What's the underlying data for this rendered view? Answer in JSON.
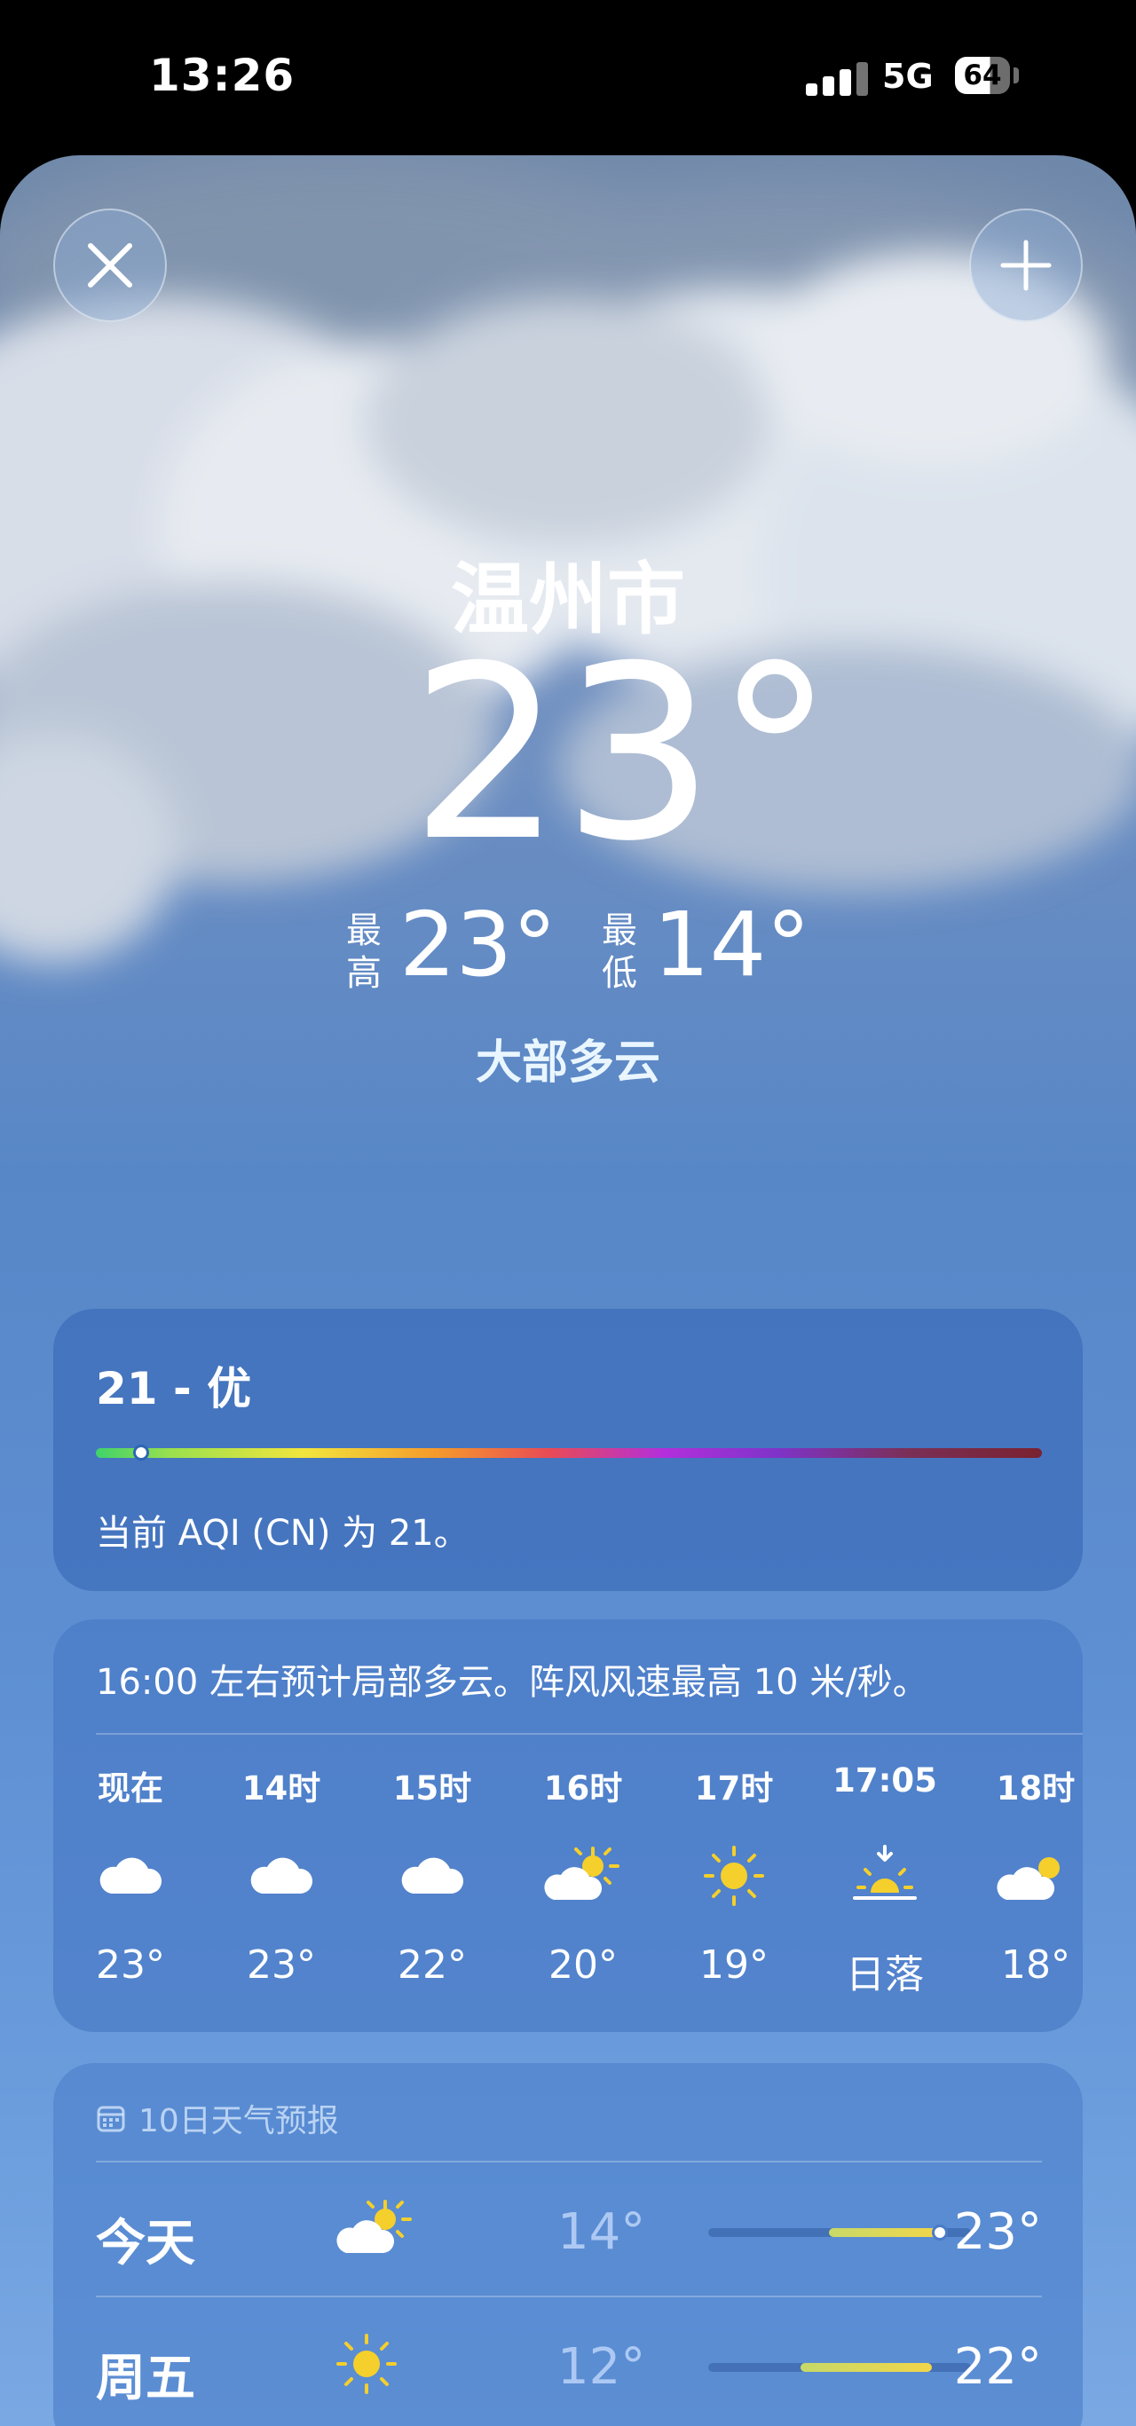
{
  "status": {
    "time": "13:26",
    "network": "5G",
    "battery": "64"
  },
  "header": {
    "close_icon": "close-icon",
    "add_icon": "plus-icon"
  },
  "current": {
    "city": "温州市",
    "temperature": "23",
    "degree": "°",
    "high_label": "最高",
    "high": "23°",
    "low_label": "最低",
    "low": "14°",
    "condition": "大部多云"
  },
  "aqi": {
    "title": "21 - 优",
    "value": 21,
    "description": "当前 AQI (CN) 为 21。"
  },
  "hourly": {
    "summary": "16:00 左右预计局部多云。阵风风速最高 10 米/秒。",
    "items": [
      {
        "label": "现在",
        "icon": "cloud-icon",
        "temp": "23°"
      },
      {
        "label": "14时",
        "icon": "cloud-icon",
        "temp": "23°"
      },
      {
        "label": "15时",
        "icon": "cloud-icon",
        "temp": "22°"
      },
      {
        "label": "16时",
        "icon": "partly-sunny-icon",
        "temp": "20°"
      },
      {
        "label": "17时",
        "icon": "sun-icon",
        "temp": "19°"
      },
      {
        "label": "17:05",
        "icon": "sunset-icon",
        "temp": "日落"
      },
      {
        "label": "18时",
        "icon": "partly-cloudy-icon",
        "temp": "18°"
      }
    ]
  },
  "daily": {
    "title": "10日天气预报",
    "title_icon": "calendar-icon",
    "items": [
      {
        "day": "今天",
        "icon": "partly-sunny-icon",
        "low": "14°",
        "high": "23°"
      },
      {
        "day": "周五",
        "icon": "sun-icon",
        "low": "12°",
        "high": "22°"
      }
    ]
  },
  "colors": {
    "sun": "#f5cf2b",
    "aqi_good": "#3fd36a",
    "range_bar": "#f2d64a"
  }
}
